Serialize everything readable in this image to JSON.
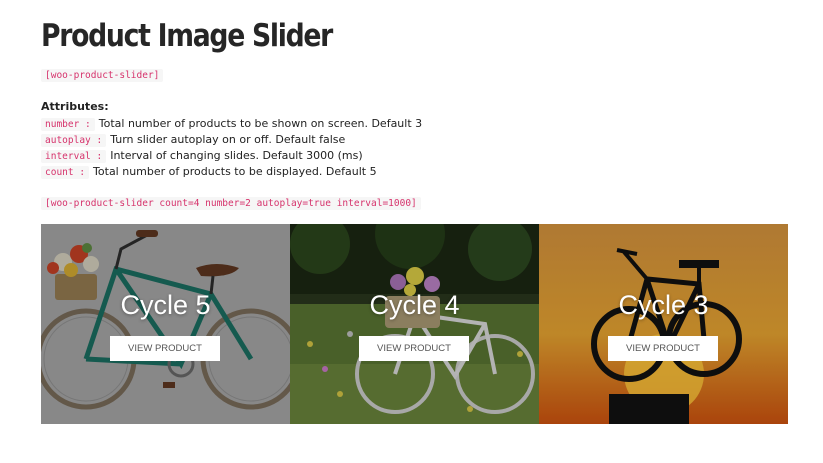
{
  "page": {
    "title": "Product Image Slider",
    "shortcode": "[woo-product-slider]",
    "attributes_heading": "Attributes:",
    "attributes": [
      {
        "name": "number :",
        "desc": "Total number of products to be shown on screen. Default 3"
      },
      {
        "name": "autoplay :",
        "desc": "Turn slider autoplay on or off. Default false"
      },
      {
        "name": "interval :",
        "desc": "Interval of changing slides. Default 3000 (ms)"
      },
      {
        "name": "count :",
        "desc": "Total number of products to be displayed. Default 5"
      }
    ],
    "example_shortcode": "[woo-product-slider count=4 number=2 autoplay=true interval=1000]"
  },
  "slider": {
    "slides": [
      {
        "title": "Cycle 5",
        "button": "VIEW PRODUCT"
      },
      {
        "title": "Cycle 4",
        "button": "VIEW PRODUCT"
      },
      {
        "title": "Cycle 3",
        "button": "VIEW PRODUCT"
      }
    ]
  },
  "colors": {
    "code_text": "#d6336c",
    "code_bg": "#f6f6f6",
    "overlay": "rgba(0,0,0,0.35)"
  }
}
